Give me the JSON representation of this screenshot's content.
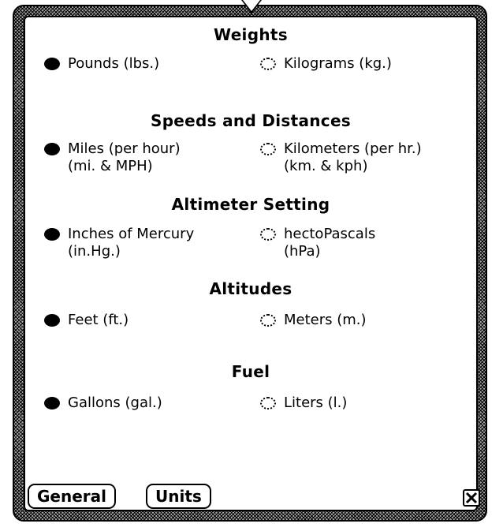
{
  "sections": [
    {
      "title": "Weights",
      "left_option": {
        "line1": "Pounds (lbs.)",
        "line2": "",
        "selected": true
      },
      "right_option": {
        "line1": "Kilograms (kg.)",
        "line2": "",
        "selected": false
      }
    },
    {
      "title": "Speeds and Distances",
      "left_option": {
        "line1": "Miles (per hour)",
        "line2": "(mi. & MPH)",
        "selected": true
      },
      "right_option": {
        "line1": "Kilometers (per hr.)",
        "line2": "(km. & kph)",
        "selected": false
      }
    },
    {
      "title": "Altimeter Setting",
      "left_option": {
        "line1": "Inches of Mercury",
        "line2": "(in.Hg.)",
        "selected": true
      },
      "right_option": {
        "line1": "hectoPascals",
        "line2": "(hPa)",
        "selected": false
      }
    },
    {
      "title": "Altitudes",
      "left_option": {
        "line1": "Feet (ft.)",
        "line2": "",
        "selected": true
      },
      "right_option": {
        "line1": "Meters (m.)",
        "line2": "",
        "selected": false
      }
    },
    {
      "title": "Fuel",
      "left_option": {
        "line1": "Gallons (gal.)",
        "line2": "",
        "selected": true
      },
      "right_option": {
        "line1": "Liters (l.)",
        "line2": "",
        "selected": false
      }
    }
  ],
  "buttons": {
    "general": "General",
    "units": "Units"
  },
  "icons": {
    "close": "close-icon",
    "radio_selected": "radio-selected-icon",
    "radio_unselected": "radio-unselected-icon"
  },
  "colors": {
    "foreground": "#000000",
    "background": "#ffffff"
  }
}
